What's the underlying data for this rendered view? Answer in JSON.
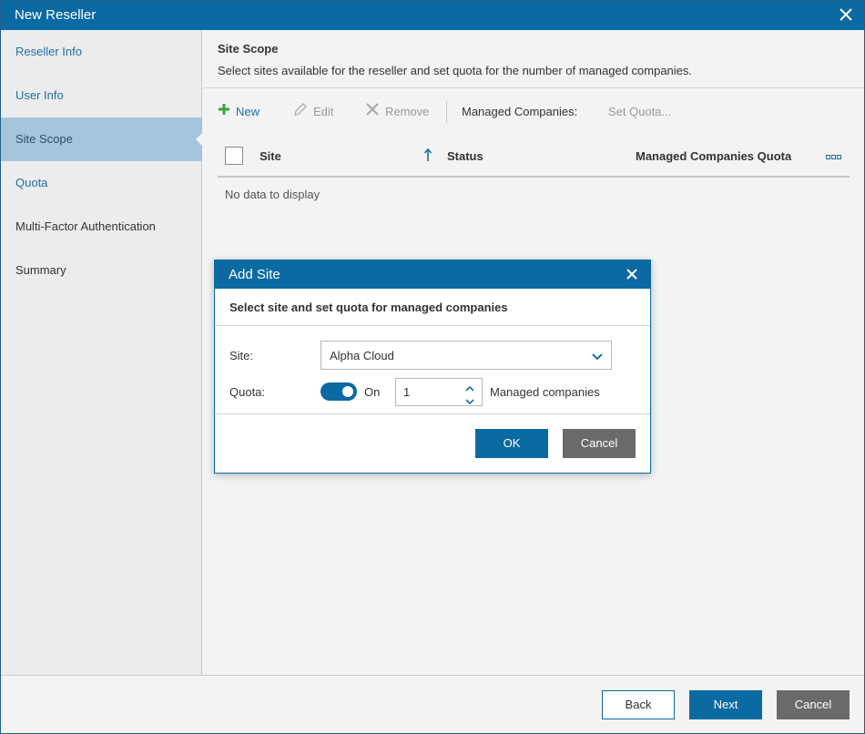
{
  "window": {
    "title": "New Reseller"
  },
  "sidebar": {
    "items": [
      {
        "label": "Reseller Info"
      },
      {
        "label": "User Info"
      },
      {
        "label": "Site Scope"
      },
      {
        "label": "Quota"
      },
      {
        "label": "Multi-Factor Authentication"
      },
      {
        "label": "Summary"
      }
    ],
    "active": "Site Scope"
  },
  "page": {
    "title": "Site Scope",
    "description": "Select sites available for the reseller and set quota for the number of managed companies."
  },
  "toolbar": {
    "new_label": "New",
    "edit_label": "Edit",
    "remove_label": "Remove",
    "managed_companies_label": "Managed Companies:",
    "set_quota_label": "Set Quota..."
  },
  "grid": {
    "columns": [
      "Site",
      "Status",
      "Managed Companies Quota"
    ],
    "empty_text": "No data to display"
  },
  "footer": {
    "back_label": "Back",
    "next_label": "Next",
    "cancel_label": "Cancel"
  },
  "dialog": {
    "title": "Add Site",
    "subtitle": "Select site and set quota for managed companies",
    "site_label": "Site:",
    "site_value": "Alpha Cloud",
    "quota_label": "Quota:",
    "toggle_state": "On",
    "quota_value": "1",
    "quota_unit": "Managed companies",
    "ok_label": "OK",
    "cancel_label": "Cancel"
  },
  "colors": {
    "accent": "#0a6aa1",
    "active_nav": "#a7c4dd",
    "new_icon": "#3aa53a"
  }
}
